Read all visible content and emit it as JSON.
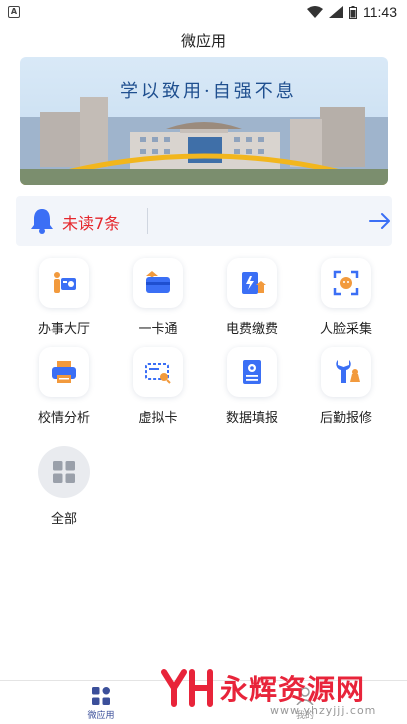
{
  "status_bar": {
    "left_icon_letter": "A",
    "time": "11:43"
  },
  "header": {
    "title": "微应用"
  },
  "banner": {
    "slogan": "学以致用·自强不息"
  },
  "notice": {
    "text": "未读7条"
  },
  "apps": [
    {
      "label": "办事大厅",
      "icon": "service-hall-icon"
    },
    {
      "label": "一卡通",
      "icon": "campus-card-icon"
    },
    {
      "label": "电费缴费",
      "icon": "electricity-bill-icon"
    },
    {
      "label": "人脸采集",
      "icon": "face-capture-icon"
    },
    {
      "label": "校情分析",
      "icon": "printer-analysis-icon"
    },
    {
      "label": "虚拟卡",
      "icon": "virtual-card-icon"
    },
    {
      "label": "数据填报",
      "icon": "data-report-icon"
    },
    {
      "label": "后勤报修",
      "icon": "repair-wrench-icon"
    },
    {
      "label": "全部",
      "icon": "all-apps-icon"
    }
  ],
  "tabbar": {
    "tabs": [
      {
        "label": "微应用"
      },
      {
        "label": "我的"
      }
    ]
  },
  "watermark": {
    "text": "永辉资源网",
    "url": "www.yhzyjjj.com"
  },
  "colors": {
    "accent": "#3b6ff5",
    "unread": "#e5262b",
    "orange": "#f29a3d"
  }
}
